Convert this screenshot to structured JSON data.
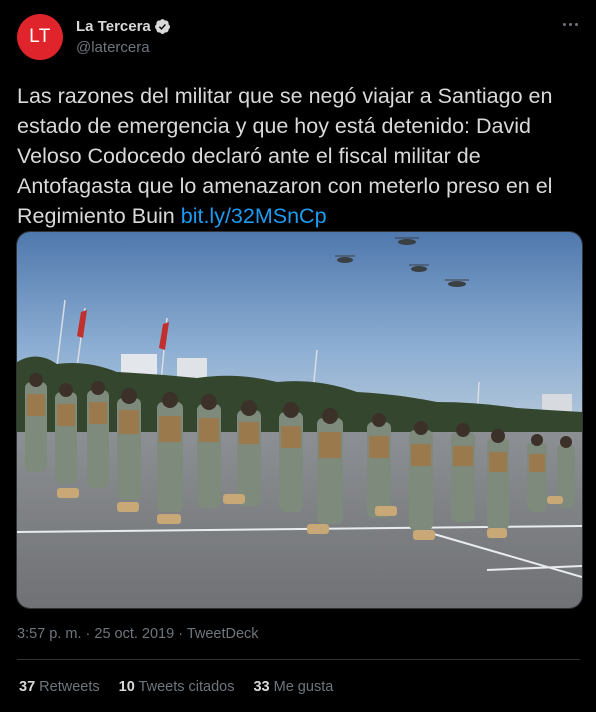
{
  "author": {
    "avatar_initials": "LT",
    "avatar_color": "#e0242b",
    "display_name": "La Tercera",
    "verified": true,
    "handle": "@latercera"
  },
  "tweet": {
    "text": "Las razones del militar que se negó viajar a Santiago en estado de emergencia y que hoy está detenido: David Veloso Codocedo declaró ante el fiscal militar de Antofagasta que lo amenazaron con meterlo preso en el Regimiento Buin ",
    "link": "bit.ly/32MSnCp",
    "link_color": "#1d9bf0"
  },
  "media": {
    "description": "soldiers-marching-photo"
  },
  "meta": {
    "time": "3:57 p. m.",
    "separator": " · ",
    "date": "25 oct. 2019",
    "client": "TweetDeck"
  },
  "stats": [
    {
      "count": "37",
      "label": "Retweets"
    },
    {
      "count": "10",
      "label": "Tweets citados"
    },
    {
      "count": "33",
      "label": "Me gusta"
    }
  ],
  "colors": {
    "background": "#000000",
    "text": "#d9d9d9",
    "secondary": "#6e767d",
    "border": "#2f3336"
  }
}
